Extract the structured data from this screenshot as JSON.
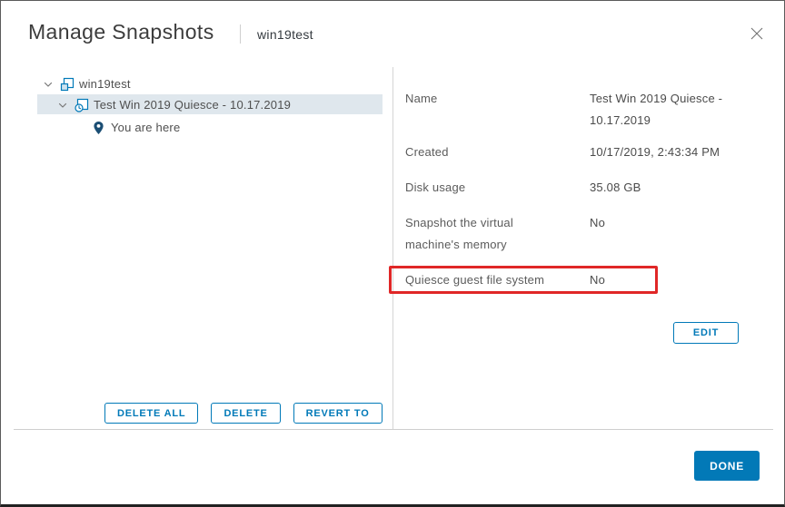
{
  "dialog": {
    "title": "Manage Snapshots",
    "subtitle": "win19test"
  },
  "tree": {
    "items": [
      {
        "icon": "vm-icon",
        "label": "win19test",
        "selected": false
      },
      {
        "icon": "snapshot-icon",
        "label": "Test Win 2019 Quiesce - 10.17.2019",
        "selected": true
      },
      {
        "icon": "location-pin-icon",
        "label": "You are here",
        "selected": false
      }
    ],
    "actions": {
      "delete_all": "DELETE ALL",
      "delete": "DELETE",
      "revert_to": "REVERT TO"
    }
  },
  "details": {
    "rows": [
      {
        "label": "Name",
        "value": "Test Win 2019 Quiesce - 10.17.2019"
      },
      {
        "label": "Created",
        "value": "10/17/2019, 2:43:34 PM"
      },
      {
        "label": "Disk usage",
        "value": "35.08 GB"
      },
      {
        "label": "Snapshot the virtual machine's memory",
        "value": "No"
      },
      {
        "label": "Quiesce guest file system",
        "value": "No",
        "annotated": true
      }
    ],
    "edit_label": "EDIT"
  },
  "footer": {
    "done_label": "DONE"
  },
  "colors": {
    "accent": "#0079b8",
    "done_button": "#0279b7",
    "selected_row": "#dfe7ed",
    "annotation_red": "#e02727",
    "pin_blue": "#1b4e74"
  }
}
